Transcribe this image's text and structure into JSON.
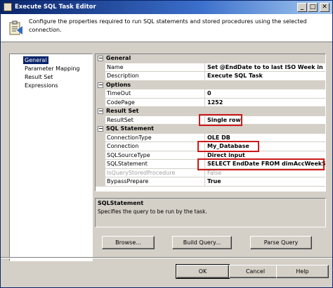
{
  "window": {
    "title": "Execute SQL Task Editor"
  },
  "titlebar_buttons": {
    "minimize": "_",
    "maximize": "□",
    "close": "✕"
  },
  "header": {
    "description": "Configure the properties required to run SQL statements and stored procedures using the selected connection."
  },
  "nav": {
    "items": [
      {
        "label": "General",
        "selected": true
      },
      {
        "label": "Parameter Mapping",
        "selected": false
      },
      {
        "label": "Result Set",
        "selected": false
      },
      {
        "label": "Expressions",
        "selected": false
      }
    ]
  },
  "grid": {
    "categories": {
      "general": "General",
      "options": "Options",
      "resultset": "Result Set",
      "sqlstatement": "SQL Statement"
    },
    "collapse_glyph": "−",
    "rows": {
      "name": {
        "name": "Name",
        "value": "Set @EndDate to to last ISO Week in"
      },
      "description": {
        "name": "Description",
        "value": "Execute SQL Task"
      },
      "timeout": {
        "name": "TimeOut",
        "value": "0"
      },
      "codepage": {
        "name": "CodePage",
        "value": "1252"
      },
      "resultset": {
        "name": "ResultSet",
        "value": "Single row"
      },
      "connectiontype": {
        "name": "ConnectionType",
        "value": "OLE DB"
      },
      "connection": {
        "name": "Connection",
        "value": "My_Database"
      },
      "sqlsourcetype": {
        "name": "SQLSourceType",
        "value": "Direct input"
      },
      "sqlstatement": {
        "name": "SQLStatement",
        "value": "SELECT EndDate FROM dimAccWeekS"
      },
      "isquerystoredprocedure": {
        "name": "IsQueryStoredProcedure",
        "value": "False"
      },
      "bypassprepare": {
        "name": "BypassPrepare",
        "value": "True"
      }
    }
  },
  "description_panel": {
    "title": "SQLStatement",
    "text": "Specifies the query to be run by the task."
  },
  "buttons": {
    "browse": "Browse...",
    "build_query": "Build Query...",
    "parse_query": "Parse Query",
    "ok": "OK",
    "cancel": "Cancel",
    "help": "Help"
  },
  "colors": {
    "highlight": "#cc1a1a",
    "selection": "#0a246a",
    "dialog": "#d4d0c8"
  }
}
